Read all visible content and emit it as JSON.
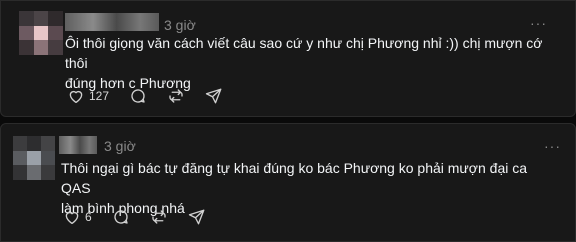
{
  "posts": [
    {
      "time": "3 giờ",
      "more": "···",
      "text_line1": "Ôi thôi giọng văn cách viết câu sao cứ y như chị Phương nhỉ :)) chị mượn cớ thôi",
      "text_line2": "đúng hơn c Phương",
      "likes": "127",
      "icons": [
        "heart-icon",
        "comment-icon",
        "repost-icon",
        "share-icon"
      ]
    },
    {
      "time": "3 giờ",
      "more": "···",
      "text_line1": "Thôi ngại gì bác tự đăng tự khai đúng ko bác Phương ko phải mượn đại ca QAS",
      "text_line2": "làm bình phong nhá",
      "likes": "6",
      "icons": [
        "heart-icon",
        "comment-icon",
        "repost-icon",
        "share-icon"
      ]
    }
  ],
  "colors": {
    "background": "#0a0a0a",
    "card": "#181818",
    "text": "#f3f5f7",
    "muted": "#8a8a8a"
  }
}
